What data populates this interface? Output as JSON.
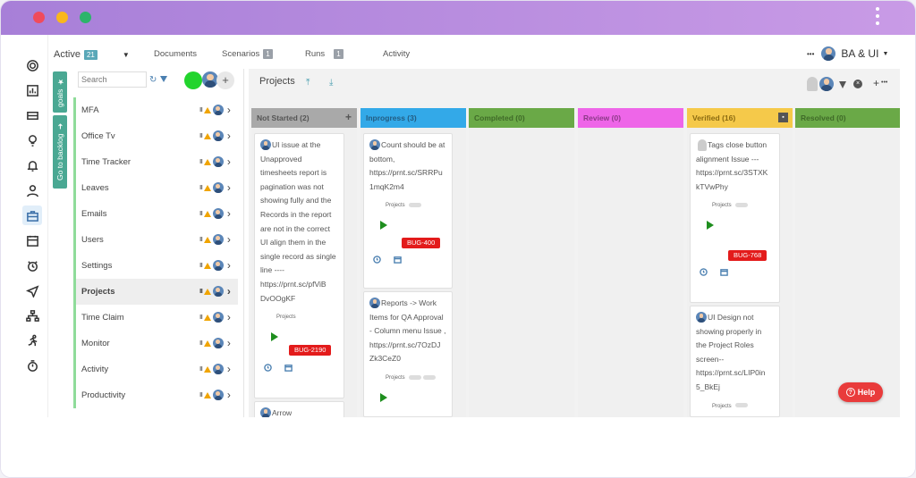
{
  "window": {
    "dot_colors": [
      "#f04b5c",
      "#f9b71d",
      "#2db46b"
    ]
  },
  "topbar": {
    "active_label": "Active",
    "active_count": "21",
    "tabs": [
      {
        "label": "Documents",
        "count": ""
      },
      {
        "label": "Scenarios",
        "count": "1"
      },
      {
        "label": "Runs",
        "count": "1"
      },
      {
        "label": "Activity",
        "count": ""
      }
    ],
    "more_label": "•••",
    "workspace": "BA & UI"
  },
  "side_tabs": {
    "goals": "goals",
    "backlog": "Go to backlog"
  },
  "left_panel": {
    "search_placeholder": "Search",
    "projects": [
      {
        "label": "MFA"
      },
      {
        "label": "Office Tv"
      },
      {
        "label": "Time Tracker"
      },
      {
        "label": "Leaves"
      },
      {
        "label": "Emails"
      },
      {
        "label": "Users"
      },
      {
        "label": "Settings"
      },
      {
        "label": "Projects"
      },
      {
        "label": "Time Claim"
      },
      {
        "label": "Monitor"
      },
      {
        "label": "Activity"
      },
      {
        "label": "Productivity"
      }
    ]
  },
  "board": {
    "title": "Projects",
    "columns": [
      {
        "label": "Not Started (2)",
        "color": "#a9a9a9"
      },
      {
        "label": "Inprogress (3)",
        "color": "#33a9e8"
      },
      {
        "label": "Completed (0)",
        "color": "#6aa947"
      },
      {
        "label": "Review (0)",
        "color": "#ee66e8"
      },
      {
        "label": "Verified (16)",
        "color": "#f5c94a"
      },
      {
        "label": "Resolved (0)",
        "color": "#6aa947"
      }
    ],
    "cards": {
      "c1": {
        "text": "UI issue at the Unapproved timesheets report is pagination was not showing fully and the Records in the report are not in the correct UI align them in the single record as single line ---- https://prnt.sc/pfViB DvOOgKF",
        "project": "Projects",
        "bug": "BUG-2190"
      },
      "c1b": {
        "text": "Arrow"
      },
      "c2": {
        "text": "Count should be at bottom, https://prnt.sc/SRRPu 1mqK2m4",
        "project": "Projects",
        "bug": "BUG-400"
      },
      "c3": {
        "text": "Reports -> Work Items for QA Approval - Column menu Issue , https://prnt.sc/7OzDJ Zk3CeZ0",
        "project": "Projects"
      },
      "c4": {
        "text": "Tags close button alignment Issue --- https://prnt.sc/3STXK kTVwPhy",
        "project": "Projects",
        "bug": "BUG-768"
      },
      "c5": {
        "text": "UI Design not showing properly in the Project Roles screen-- https://prnt.sc/LIP0in 5_BkEj",
        "project": "Projects"
      }
    }
  },
  "help": {
    "label": "Help"
  }
}
